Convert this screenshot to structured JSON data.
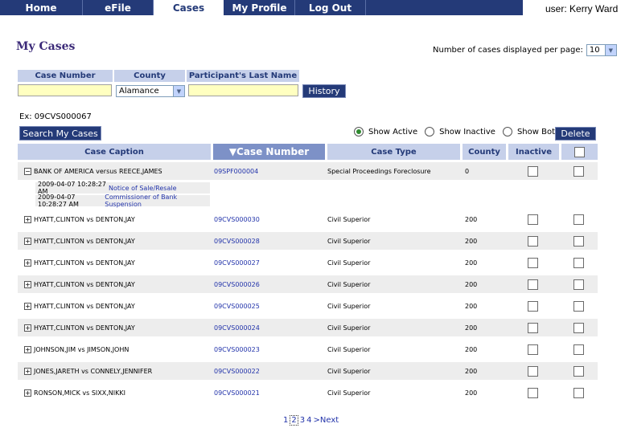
{
  "nav": {
    "tabs": [
      "Home",
      "eFile",
      "Cases",
      "My Profile",
      "Log Out"
    ],
    "active": "Cases"
  },
  "user": "user: Kerry Ward",
  "page_title": "My Cases",
  "per_page": {
    "label": "Number of cases displayed per page:",
    "value": "10"
  },
  "search": {
    "case_number_label": "Case Number",
    "county_label": "County",
    "participant_label": "Participant's Last Name",
    "county_value": "Alamance",
    "history_button": "History",
    "example": "Ex:  09CVS000067",
    "search_button": "Search My Cases"
  },
  "filters": {
    "show_active": "Show Active",
    "show_inactive": "Show Inactive",
    "show_both": "Show Both",
    "selected": "Show Active",
    "delete_button": "Delete"
  },
  "table": {
    "headers": {
      "caption": "Case Caption",
      "case_number": "▼Case Number",
      "case_type": "Case Type",
      "county": "County",
      "inactive": "Inactive"
    },
    "rows": [
      {
        "caption": "BANK OF AMERICA versus  REECE,JAMES",
        "case_number": "09SPF000004",
        "case_type": "Special Proceedings Foreclosure",
        "county": "0",
        "expanded": true,
        "documents": [
          {
            "timestamp": "2009-04-07 10:28:27 AM",
            "title": "Notice of Sale/Resale"
          },
          {
            "timestamp": "2009-04-07 10:28:27 AM",
            "title": "Commissioner of Bank Suspension"
          }
        ]
      },
      {
        "caption": "HYATT,CLINTON vs DENTON,JAY",
        "case_number": "09CVS000030",
        "case_type": "Civil Superior",
        "county": "200"
      },
      {
        "caption": "HYATT,CLINTON vs DENTON,JAY",
        "case_number": "09CVS000028",
        "case_type": "Civil Superior",
        "county": "200"
      },
      {
        "caption": "HYATT,CLINTON vs DENTON,JAY",
        "case_number": "09CVS000027",
        "case_type": "Civil Superior",
        "county": "200"
      },
      {
        "caption": "HYATT,CLINTON vs DENTON,JAY",
        "case_number": "09CVS000026",
        "case_type": "Civil Superior",
        "county": "200"
      },
      {
        "caption": "HYATT,CLINTON vs DENTON,JAY",
        "case_number": "09CVS000025",
        "case_type": "Civil Superior",
        "county": "200"
      },
      {
        "caption": "HYATT,CLINTON vs DENTON,JAY",
        "case_number": "09CVS000024",
        "case_type": "Civil Superior",
        "county": "200"
      },
      {
        "caption": "JOHNSON,JIM vs JIMSON,JOHN",
        "case_number": "09CVS000023",
        "case_type": "Civil Superior",
        "county": "200"
      },
      {
        "caption": "JONES,JARETH vs CONNELY,JENNIFER",
        "case_number": "09CVS000022",
        "case_type": "Civil Superior",
        "county": "200"
      },
      {
        "caption": "RONSON,MICK vs SIXX,NIKKI",
        "case_number": "09CVS000021",
        "case_type": "Civil Superior",
        "county": "200"
      }
    ]
  },
  "pagination": {
    "pages": [
      "1",
      "2",
      "3",
      "4"
    ],
    "current": "2",
    "next": ">Next"
  },
  "colors": {
    "nav": "#243a78",
    "header": "#c6d0ea",
    "sorted_header": "#7d91c7",
    "input": "#ffffc0",
    "alt_row": "#ededed",
    "link": "#2233aa"
  }
}
